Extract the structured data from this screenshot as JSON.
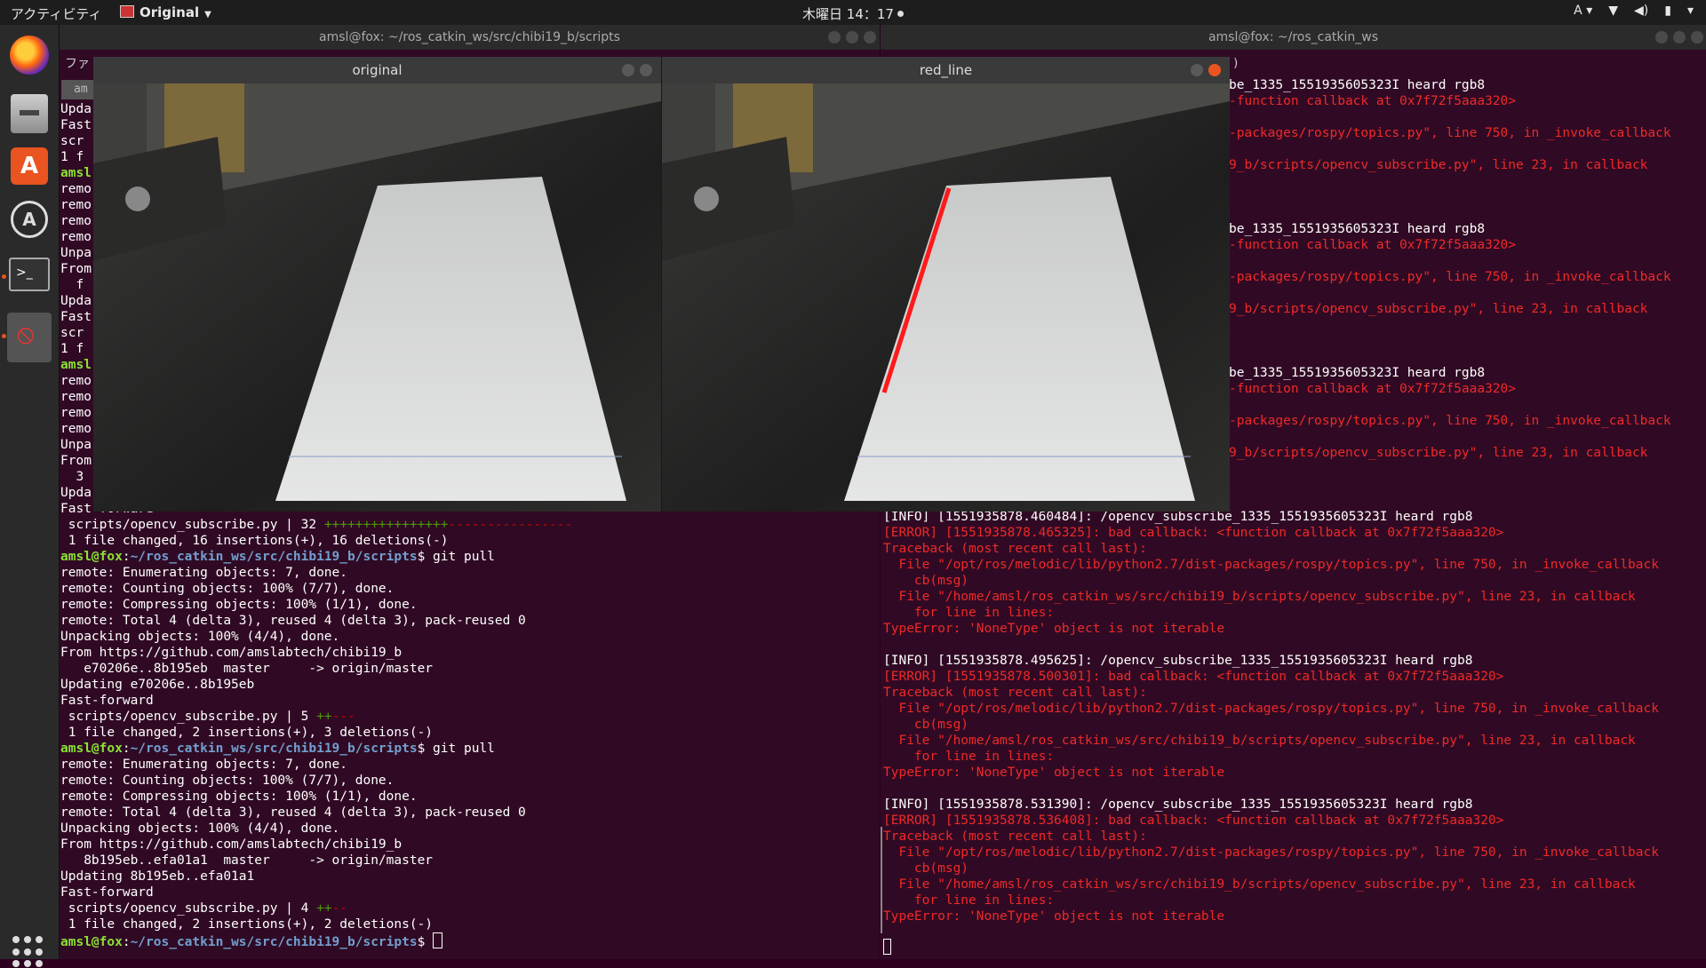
{
  "topbar": {
    "activities": "アクティビティ",
    "app_menu": "Original",
    "clock": "木曜日 14：17",
    "input_method": "A"
  },
  "dock": {
    "items": [
      "firefox-icon",
      "files-icon",
      "software-icon",
      "updater-icon",
      "terminal-icon",
      "blocked-app-icon",
      "show-apps-icon"
    ]
  },
  "left_terminal": {
    "title": "amsl@fox: ~/ros_catkin_ws/src/chibi19_b/scripts",
    "menu_fragment": "ファ",
    "tab_fragment": "am",
    "partial_lines": [
      "Upda",
      "Fast",
      "scr",
      "1 f",
      "amsl",
      "remo",
      "remo",
      "remo",
      "remo",
      "Unpa",
      "From",
      "  f",
      "Upda",
      "Fast",
      "scr",
      "1 f",
      "amsl",
      "remo",
      "remo",
      "remo",
      "remo",
      "Unpa",
      "From",
      "  3",
      "Upda"
    ],
    "lines": [
      {
        "t": "Fast-forward",
        "c": ""
      },
      {
        "t": " scripts/opencv_subscribe.py | 32 ",
        "c": "",
        "plus": "++++++++++++++++",
        "minus": "----------------"
      },
      {
        "t": " 1 file changed, 16 insertions(+), 16 deletions(-)",
        "c": ""
      },
      {
        "prompt_user": "amsl@fox",
        "prompt_path": "~/ros_catkin_ws/src/chibi19_b/scripts",
        "cmd": "$ git pull"
      },
      {
        "t": "remote: Enumerating objects: 7, done.",
        "c": ""
      },
      {
        "t": "remote: Counting objects: 100% (7/7), done.",
        "c": ""
      },
      {
        "t": "remote: Compressing objects: 100% (1/1), done.",
        "c": ""
      },
      {
        "t": "remote: Total 4 (delta 3), reused 4 (delta 3), pack-reused 0",
        "c": ""
      },
      {
        "t": "Unpacking objects: 100% (4/4), done.",
        "c": ""
      },
      {
        "t": "From https://github.com/amslabtech/chibi19_b",
        "c": ""
      },
      {
        "t": "   e70206e..8b195eb  master     -> origin/master",
        "c": ""
      },
      {
        "t": "Updating e70206e..8b195eb",
        "c": ""
      },
      {
        "t": "Fast-forward",
        "c": ""
      },
      {
        "t": " scripts/opencv_subscribe.py | 5 ",
        "c": "",
        "plus": "++",
        "minus": "---"
      },
      {
        "t": " 1 file changed, 2 insertions(+), 3 deletions(-)",
        "c": ""
      },
      {
        "prompt_user": "amsl@fox",
        "prompt_path": "~/ros_catkin_ws/src/chibi19_b/scripts",
        "cmd": "$ git pull"
      },
      {
        "t": "remote: Enumerating objects: 7, done.",
        "c": ""
      },
      {
        "t": "remote: Counting objects: 100% (7/7), done.",
        "c": ""
      },
      {
        "t": "remote: Compressing objects: 100% (1/1), done.",
        "c": ""
      },
      {
        "t": "remote: Total 4 (delta 3), reused 4 (delta 3), pack-reused 0",
        "c": ""
      },
      {
        "t": "Unpacking objects: 100% (4/4), done.",
        "c": ""
      },
      {
        "t": "From https://github.com/amslabtech/chibi19_b",
        "c": ""
      },
      {
        "t": "   8b195eb..efa01a1  master     -> origin/master",
        "c": ""
      },
      {
        "t": "Updating 8b195eb..efa01a1",
        "c": ""
      },
      {
        "t": "Fast-forward",
        "c": ""
      },
      {
        "t": " scripts/opencv_subscribe.py | 4 ",
        "c": "",
        "plus": "++",
        "minus": "--"
      },
      {
        "t": " 1 file changed, 2 insertions(+), 2 deletions(-)",
        "c": ""
      },
      {
        "prompt_user": "amsl@fox",
        "prompt_path": "~/ros_catkin_ws/src/chibi19_b/scripts",
        "cmd": "$ "
      }
    ]
  },
  "right_terminal": {
    "title": "amsl@fox: ~/ros_catkin_ws",
    "menu_fragment": ")",
    "top_lines": [
      {
        "t": "be_1335_1551935605323I heard rgb8",
        "c": ""
      },
      {
        "t": "-function callback at 0x7f72f5aaa320>",
        "c": "red"
      },
      {
        "t": "",
        "c": ""
      },
      {
        "t": "-packages/rospy/topics.py\", line 750, in _invoke_callback",
        "c": "red"
      },
      {
        "t": "",
        "c": ""
      },
      {
        "t": "9_b/scripts/opencv_subscribe.py\", line 23, in callback",
        "c": "red"
      },
      {
        "t": "",
        "c": ""
      },
      {
        "t": "",
        "c": ""
      },
      {
        "t": "",
        "c": ""
      },
      {
        "t": "be_1335_1551935605323I heard rgb8",
        "c": ""
      },
      {
        "t": "-function callback at 0x7f72f5aaa320>",
        "c": "red"
      },
      {
        "t": "",
        "c": ""
      },
      {
        "t": "-packages/rospy/topics.py\", line 750, in _invoke_callback",
        "c": "red"
      },
      {
        "t": "",
        "c": ""
      },
      {
        "t": "9_b/scripts/opencv_subscribe.py\", line 23, in callback",
        "c": "red"
      },
      {
        "t": "",
        "c": ""
      },
      {
        "t": "",
        "c": ""
      },
      {
        "t": "",
        "c": ""
      },
      {
        "t": "be_1335_1551935605323I heard rgb8",
        "c": ""
      },
      {
        "t": "-function callback at 0x7f72f5aaa320>",
        "c": "red"
      },
      {
        "t": "",
        "c": ""
      },
      {
        "t": "-packages/rospy/topics.py\", line 750, in _invoke_callback",
        "c": "red"
      },
      {
        "t": "",
        "c": ""
      },
      {
        "t": "9_b/scripts/opencv_subscribe.py\", line 23, in callback",
        "c": "red"
      }
    ],
    "lines": [
      {
        "t": "[INFO] [1551935878.460484]: /opencv_subscribe_1335_1551935605323I heard rgb8",
        "c": ""
      },
      {
        "t": "[ERROR] [1551935878.465325]: bad callback: <function callback at 0x7f72f5aaa320>",
        "c": "red"
      },
      {
        "t": "Traceback (most recent call last):",
        "c": "red"
      },
      {
        "t": "  File \"/opt/ros/melodic/lib/python2.7/dist-packages/rospy/topics.py\", line 750, in _invoke_callback",
        "c": "red"
      },
      {
        "t": "    cb(msg)",
        "c": "red"
      },
      {
        "t": "  File \"/home/amsl/ros_catkin_ws/src/chibi19_b/scripts/opencv_subscribe.py\", line 23, in callback",
        "c": "red"
      },
      {
        "t": "    for line in lines:",
        "c": "red"
      },
      {
        "t": "TypeError: 'NoneType' object is not iterable",
        "c": "red"
      },
      {
        "t": "",
        "c": ""
      },
      {
        "t": "[INFO] [1551935878.495625]: /opencv_subscribe_1335_1551935605323I heard rgb8",
        "c": ""
      },
      {
        "t": "[ERROR] [1551935878.500301]: bad callback: <function callback at 0x7f72f5aaa320>",
        "c": "red"
      },
      {
        "t": "Traceback (most recent call last):",
        "c": "red"
      },
      {
        "t": "  File \"/opt/ros/melodic/lib/python2.7/dist-packages/rospy/topics.py\", line 750, in _invoke_callback",
        "c": "red"
      },
      {
        "t": "    cb(msg)",
        "c": "red"
      },
      {
        "t": "  File \"/home/amsl/ros_catkin_ws/src/chibi19_b/scripts/opencv_subscribe.py\", line 23, in callback",
        "c": "red"
      },
      {
        "t": "    for line in lines:",
        "c": "red"
      },
      {
        "t": "TypeError: 'NoneType' object is not iterable",
        "c": "red"
      },
      {
        "t": "",
        "c": ""
      },
      {
        "t": "[INFO] [1551935878.531390]: /opencv_subscribe_1335_1551935605323I heard rgb8",
        "c": ""
      },
      {
        "t": "[ERROR] [1551935878.536408]: bad callback: <function callback at 0x7f72f5aaa320>",
        "c": "red"
      },
      {
        "t": "Traceback (most recent call last):",
        "c": "red"
      },
      {
        "t": "  File \"/opt/ros/melodic/lib/python2.7/dist-packages/rospy/topics.py\", line 750, in _invoke_callback",
        "c": "red"
      },
      {
        "t": "    cb(msg)",
        "c": "red"
      },
      {
        "t": "  File \"/home/amsl/ros_catkin_ws/src/chibi19_b/scripts/opencv_subscribe.py\", line 23, in callback",
        "c": "red"
      },
      {
        "t": "    for line in lines:",
        "c": "red"
      },
      {
        "t": "TypeError: 'NoneType' object is not iterable",
        "c": "red"
      }
    ]
  },
  "windows": {
    "original_title": "original",
    "red_line_title": "red_line"
  }
}
